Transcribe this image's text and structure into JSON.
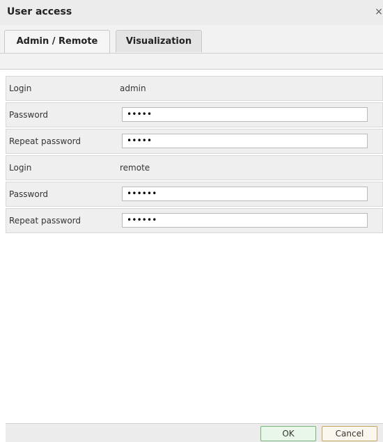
{
  "dialog": {
    "title": "User access",
    "close_glyph": "×"
  },
  "tabs": [
    {
      "label": "Admin / Remote",
      "active": true
    },
    {
      "label": "Visualization",
      "active": false
    }
  ],
  "rows": [
    {
      "label": "Login",
      "value": "admin",
      "type": "text"
    },
    {
      "label": "Password",
      "value": "•••••",
      "type": "password"
    },
    {
      "label": "Repeat password",
      "value": "•••••",
      "type": "password"
    },
    {
      "label": "Login",
      "value": "remote",
      "type": "text"
    },
    {
      "label": "Password",
      "value": "••••••",
      "type": "password"
    },
    {
      "label": "Repeat password",
      "value": "••••••",
      "type": "password"
    }
  ],
  "buttons": {
    "ok_label": "OK",
    "cancel_label": "Cancel"
  },
  "colors": {
    "ok_border": "#76b27a",
    "cancel_border": "#c6a45b"
  }
}
